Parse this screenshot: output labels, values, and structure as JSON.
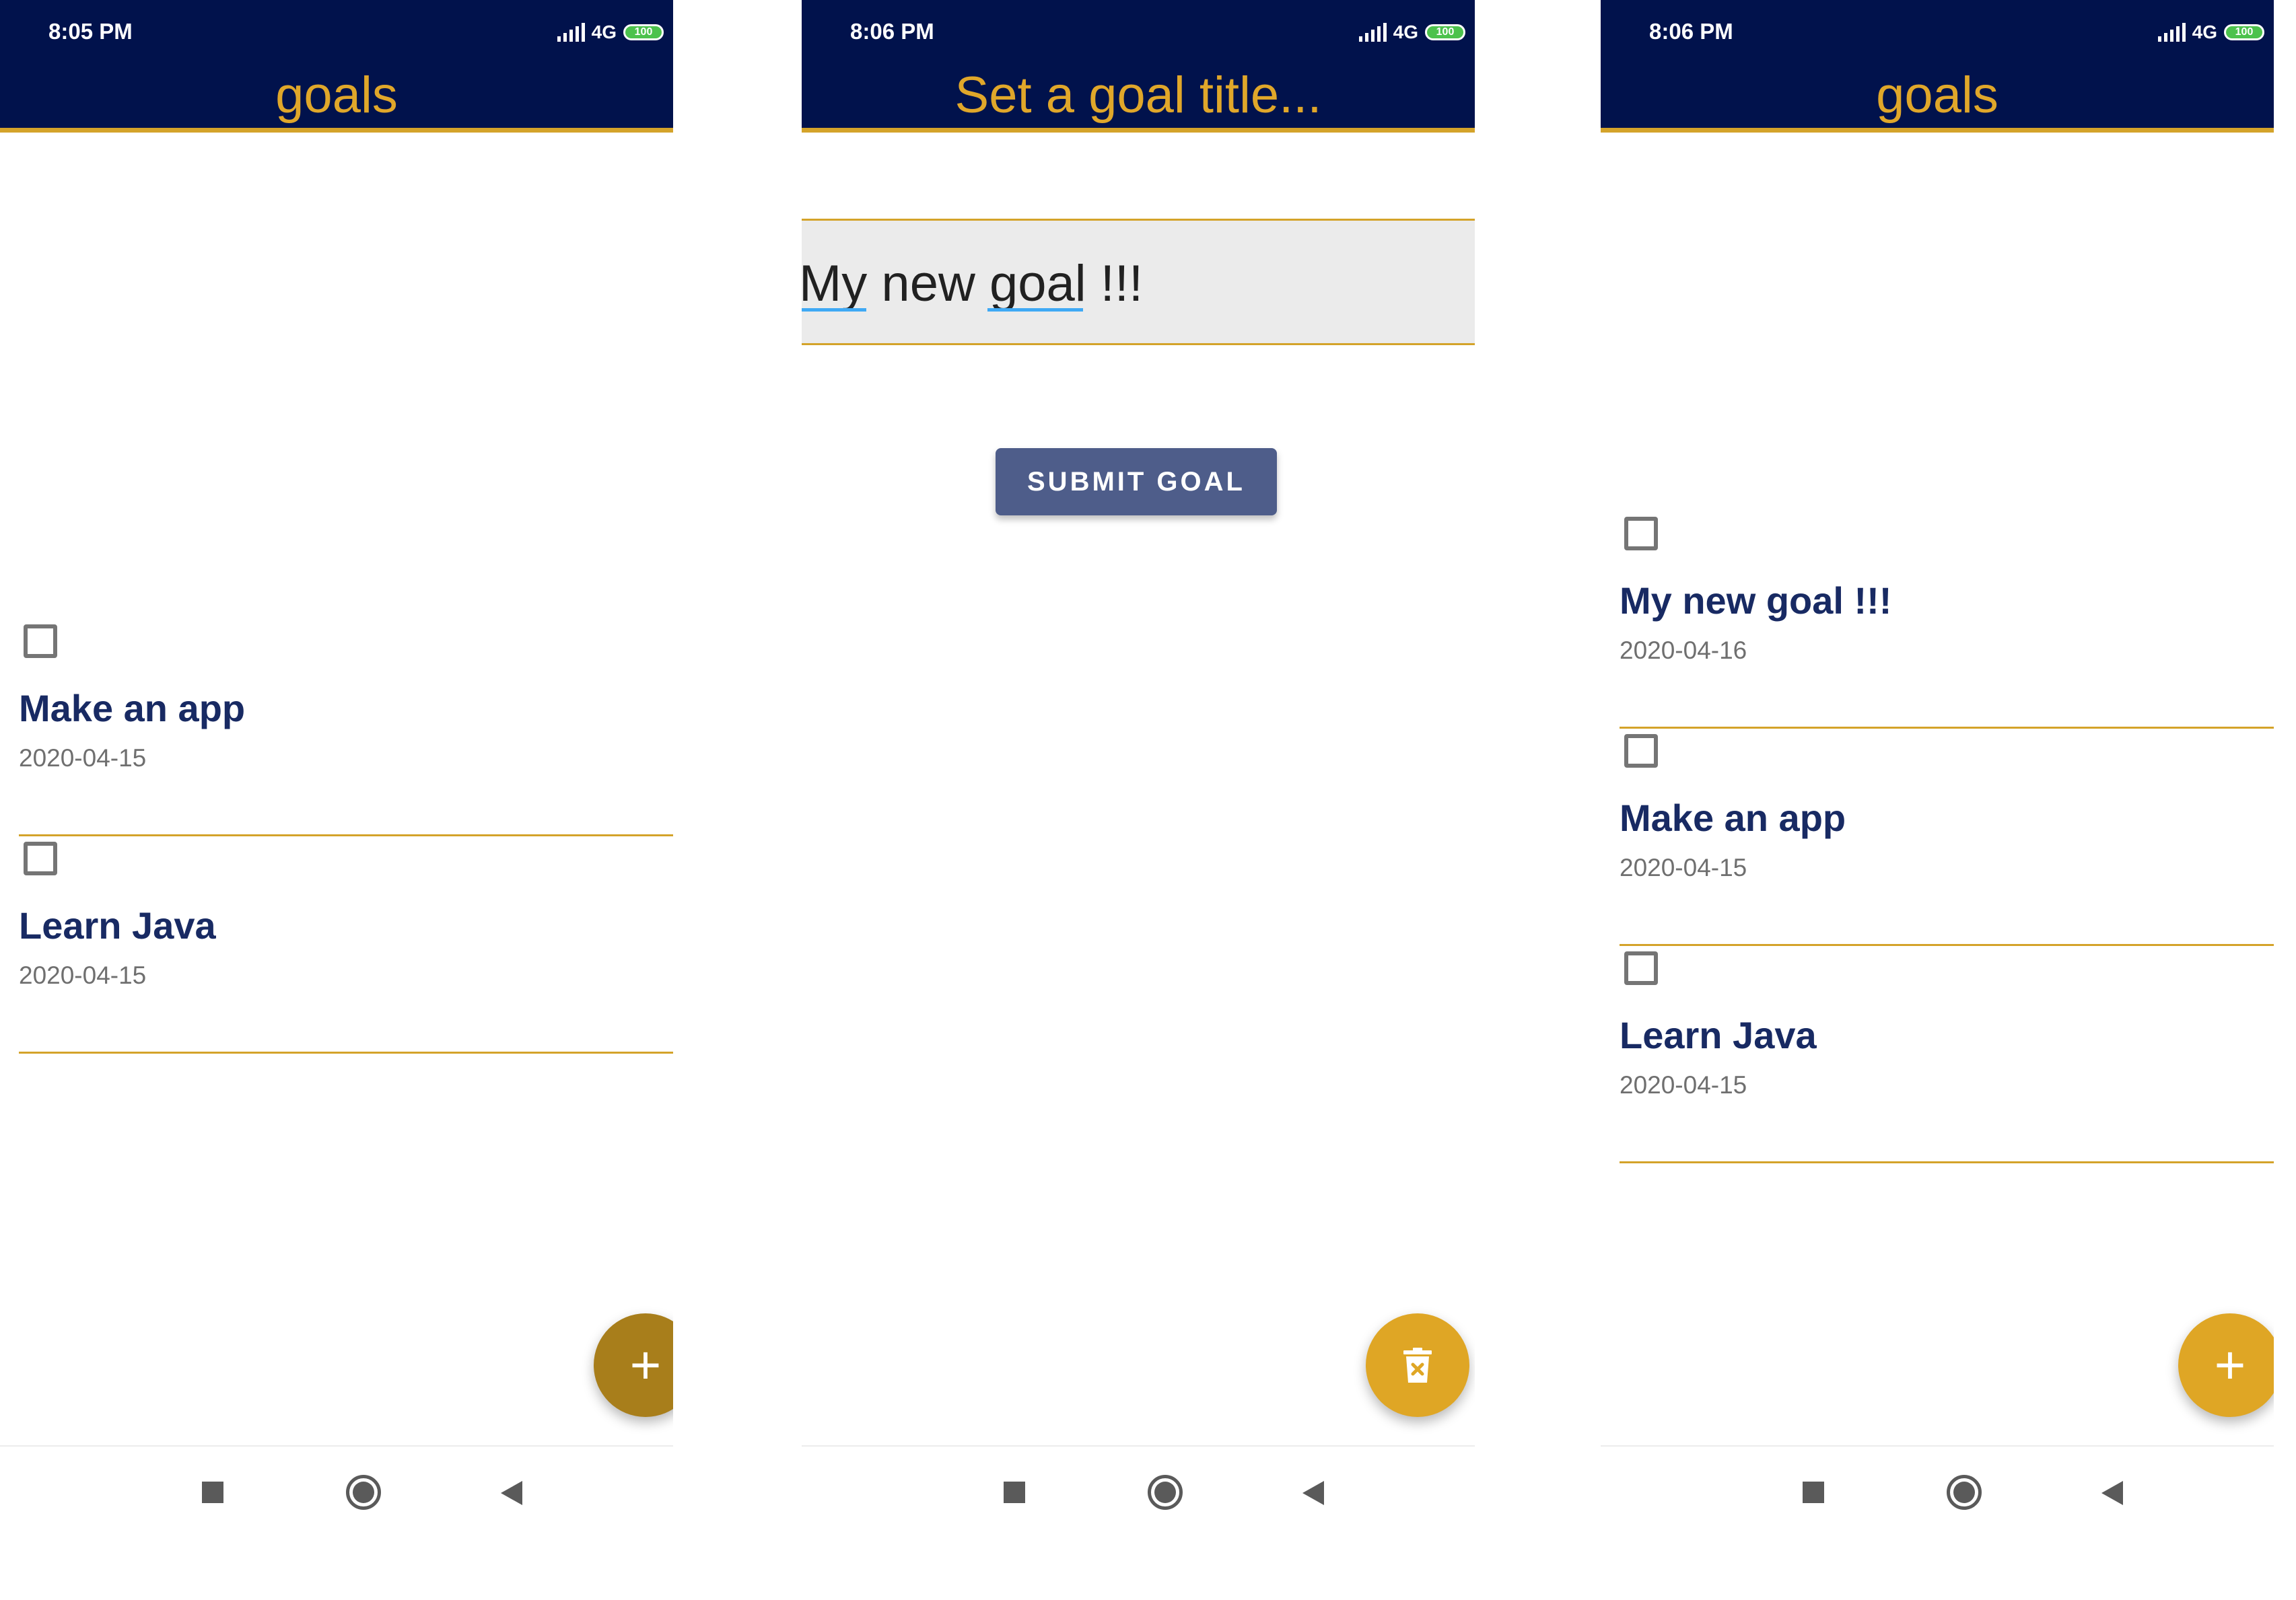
{
  "status": {
    "time_1": "8:05 PM",
    "time_2": "8:06 PM",
    "time_3": "8:06 PM",
    "network": "4G",
    "battery": "100"
  },
  "screen_list_before": {
    "title": "goals",
    "goals": [
      {
        "title": "Make an app",
        "date": "2020-04-15",
        "checked": false
      },
      {
        "title": "Learn Java",
        "date": "2020-04-15",
        "checked": false
      }
    ],
    "fab_icon": "plus-icon"
  },
  "screen_add_goal": {
    "title": "Set a goal title...",
    "input_value": "My new goal !!!",
    "submit_label": "SUBMIT GOAL",
    "fab_icon": "trash-icon"
  },
  "screen_list_after": {
    "title": "goals",
    "goals": [
      {
        "title": "My new goal !!!",
        "date": "2020-04-16",
        "checked": false
      },
      {
        "title": "Make an app",
        "date": "2020-04-15",
        "checked": false
      },
      {
        "title": "Learn Java",
        "date": "2020-04-15",
        "checked": false
      }
    ],
    "fab_icon": "plus-icon"
  },
  "nav": {
    "recents_icon": "square-icon",
    "home_icon": "circle-home-icon",
    "back_icon": "back-triangle-icon"
  },
  "colors": {
    "app_bar": "#01124c",
    "accent_gold": "#e0a72a",
    "fab_pressed": "#a87e1b",
    "fab": "#dfa625",
    "submit_button": "#4e5d8a",
    "goal_title": "#182a63"
  }
}
